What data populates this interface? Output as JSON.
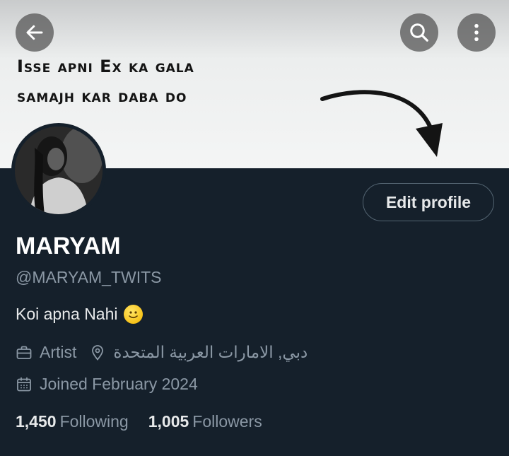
{
  "banner": {
    "line1": "Isse apni Ex ka gala",
    "line2": "samajh kar daba do"
  },
  "profile": {
    "name": "MARYAM",
    "handle": "@MARYAM_TWITS",
    "bio": "Koi apna Nahi",
    "profession": "Artist",
    "location": "دبي, الامارات العربية المتحدة",
    "joined": "Joined February 2024",
    "following_count": "1,450",
    "following_label": "Following",
    "followers_count": "1,005",
    "followers_label": "Followers"
  },
  "actions": {
    "edit_profile": "Edit profile"
  },
  "icons": {
    "back": "arrow-left-icon",
    "search": "search-icon",
    "more": "more-vertical-icon",
    "profession": "briefcase-icon",
    "location": "location-pin-icon",
    "joined": "calendar-icon"
  },
  "colors": {
    "background": "#15202b",
    "text_primary": "#e7e9ea",
    "text_secondary": "#8b98a5",
    "border": "#536471"
  }
}
